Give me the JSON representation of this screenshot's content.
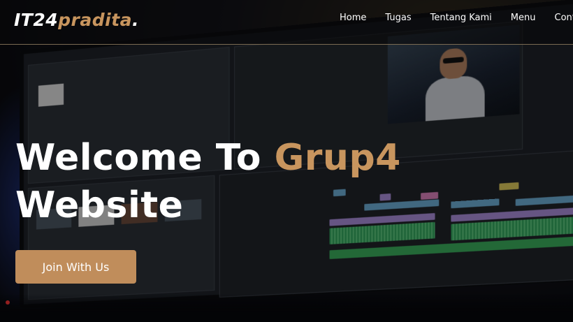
{
  "brand": {
    "name_main": "IT24",
    "name_accent": "pradita",
    "name_dot": "."
  },
  "nav": {
    "items": [
      {
        "label": "Home"
      },
      {
        "label": "Tugas"
      },
      {
        "label": "Tentang Kami"
      },
      {
        "label": "Menu"
      },
      {
        "label": "Conta"
      }
    ]
  },
  "hero": {
    "title_line1_prefix": "Welcome To ",
    "title_line1_accent": "Grup4",
    "title_line2": "Website",
    "cta_label": "Join With Us"
  },
  "colors": {
    "accent": "#c8955e",
    "button": "#c08d5b",
    "nav_border": "#7a6a52"
  }
}
